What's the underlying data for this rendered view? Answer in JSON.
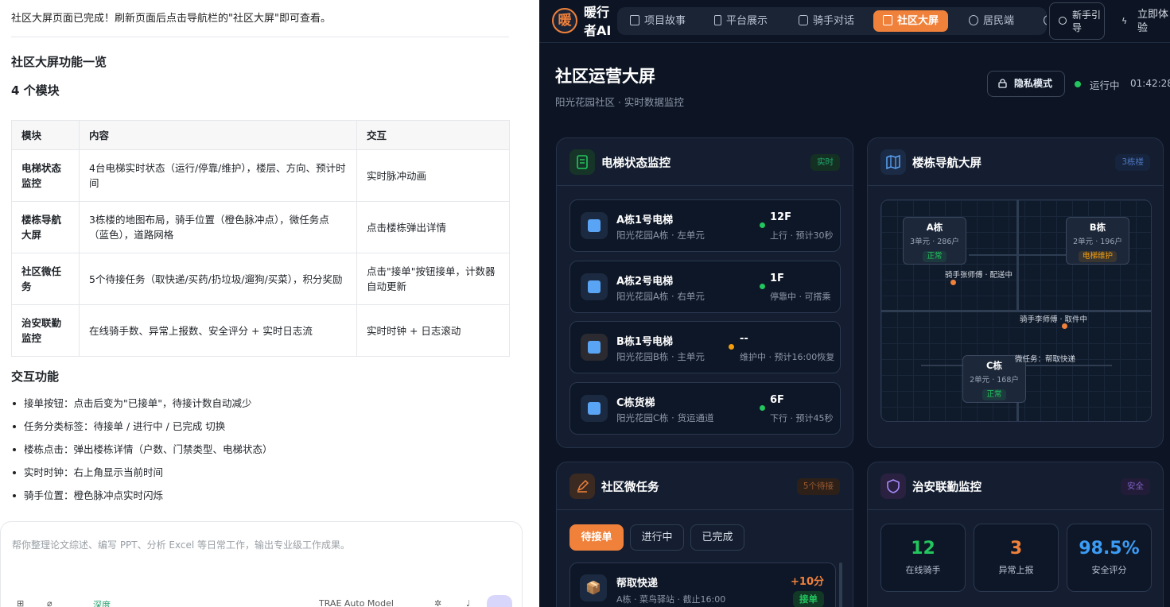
{
  "chat": {
    "intro": "社区大屏页面已完成！刷新页面后点击导航栏的\"社区大屏\"即可查看。",
    "heading_overview": "社区大屏功能一览",
    "heading_modules": "4 个模块",
    "table": {
      "headers": [
        "模块",
        "内容",
        "交互"
      ],
      "rows": [
        {
          "module": "电梯状态监控",
          "content": "4台电梯实时状态（运行/停靠/维护），楼层、方向、预计时间",
          "interaction": "实时脉冲动画"
        },
        {
          "module": "楼栋导航大屏",
          "content": "3栋楼的地图布局，骑手位置（橙色脉冲点），微任务点（蓝色），道路网格",
          "interaction": "点击楼栋弹出详情"
        },
        {
          "module": "社区微任务",
          "content": "5个待接任务（取快递/买药/扔垃圾/遛狗/买菜），积分奖励",
          "interaction": "点击\"接单\"按钮接单，计数器自动更新"
        },
        {
          "module": "治安联勤监控",
          "content": "在线骑手数、异常上报数、安全评分 + 实时日志流",
          "interaction": "实时时钟 + 日志滚动"
        }
      ]
    },
    "heading_interactions": "交互功能",
    "bullets": [
      "接单按钮：点击后变为\"已接单\"，待接计数自动减少",
      "任务分类标签：待接单 / 进行中 / 已完成 切换",
      "楼栋点击：弹出楼栋详情（户数、门禁类型、电梯状态）",
      "实时时钟：右上角显示当前时间",
      "骑手位置：橙色脉冲点实时闪烁"
    ],
    "input_placeholder": "帮你整理论文综述、编写 PPT、分析 Excel 等日常工作，输出专业级工作成果。",
    "toolbar_mode": "深度",
    "model_name": "TRAE Auto Model"
  },
  "app": {
    "logo_char": "暖",
    "brand": "暖行者AI",
    "nav": [
      {
        "label": "项目故事",
        "active": false
      },
      {
        "label": "平台展示",
        "active": false
      },
      {
        "label": "骑手对话",
        "active": false
      },
      {
        "label": "社区大屏",
        "active": true
      },
      {
        "label": "居民端",
        "active": false
      }
    ],
    "guide_label": "新手引导",
    "try_label": "立即体验",
    "page_title": "社区运营大屏",
    "page_subtitle": "阳光花园社区 · 实时数据监控",
    "privacy_label": "隐私模式",
    "status_label": "运行中",
    "clock": "01:42:28",
    "elevator": {
      "title": "电梯状态监控",
      "badge": "实时",
      "items": [
        {
          "name": "A栋1号电梯",
          "location": "阳光花园A栋 · 左单元",
          "floor": "12F",
          "status": "上行 · 预计30秒",
          "state_color": "#22c55e"
        },
        {
          "name": "A栋2号电梯",
          "location": "阳光花园A栋 · 右单元",
          "floor": "1F",
          "status": "停靠中 · 可搭乘",
          "state_color": "#22c55e"
        },
        {
          "name": "B栋1号电梯",
          "location": "阳光花园B栋 · 主单元",
          "floor": "--",
          "status": "维护中 · 预计16:00恢复",
          "state_color": "#f59e0b"
        },
        {
          "name": "C栋货梯",
          "location": "阳光花园C栋 · 货运通道",
          "floor": "6F",
          "status": "下行 · 预计45秒",
          "state_color": "#22c55e"
        }
      ]
    },
    "map": {
      "title": "楼栋导航大屏",
      "badge": "3栋楼",
      "buildings": [
        {
          "name": "A栋",
          "info": "3单元 · 286户",
          "status": "正常",
          "status_color": "#22c55e"
        },
        {
          "name": "B栋",
          "info": "2单元 · 196户",
          "status": "电梯维护",
          "status_color": "#f59e0b"
        },
        {
          "name": "C栋",
          "info": "2单元 · 168户",
          "status": "正常",
          "status_color": "#22c55e"
        }
      ],
      "labels": {
        "rider1": "骑手张师傅 · 配送中",
        "rider2": "骑手李师傅 · 取件中",
        "task1": "微任务：帮取快递"
      }
    },
    "tasks": {
      "title": "社区微任务",
      "badge": "5个待接",
      "tabs": [
        "待接单",
        "进行中",
        "已完成"
      ],
      "items": [
        {
          "name": "帮取快递",
          "location": "A栋 · 菜鸟驿站 · 截止16:00",
          "points": "+10分",
          "action": "接单"
        }
      ]
    },
    "security": {
      "title": "治安联勤监控",
      "badge": "安全",
      "stats": [
        {
          "value": "12",
          "label": "在线骑手",
          "color": "#22c55e"
        },
        {
          "value": "3",
          "label": "异常上报",
          "color": "#f0813b"
        },
        {
          "value": "98.5%",
          "label": "安全评分",
          "color": "#3b9cf5"
        }
      ]
    }
  }
}
